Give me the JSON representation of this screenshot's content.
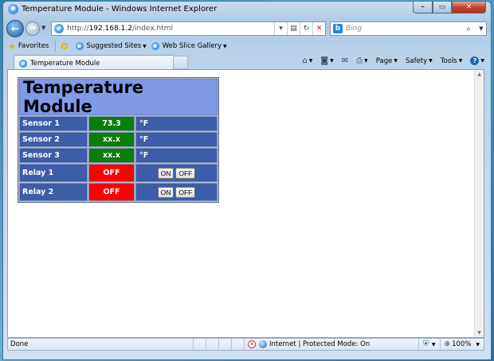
{
  "window": {
    "title": "Temperature Module - Windows Internet Explorer",
    "controls": {
      "minimize": "–",
      "maximize": "▭",
      "close": "✕"
    }
  },
  "address_bar": {
    "url_prefix": "http://",
    "url_host": "192.168.1.2",
    "url_path": "/index.html",
    "search_placeholder": "Bing",
    "bing_glyph": "b"
  },
  "favorites_bar": {
    "favorites_label": "Favorites",
    "suggested_sites": "Suggested Sites",
    "web_slice_gallery": "Web Slice Gallery"
  },
  "tabs": [
    {
      "label": "Temperature Module"
    }
  ],
  "command_bar": {
    "page": "Page",
    "safety": "Safety",
    "tools": "Tools"
  },
  "page": {
    "title": "Temperature Module",
    "sensors": [
      {
        "label": "Sensor 1",
        "value": "73.3",
        "unit": "°F"
      },
      {
        "label": "Sensor 2",
        "value": "xx.x",
        "unit": "°F"
      },
      {
        "label": "Sensor 3",
        "value": "xx.x",
        "unit": "°F"
      }
    ],
    "relays": [
      {
        "label": "Relay 1",
        "state": "OFF",
        "on_label": "ON",
        "off_label": "OFF"
      },
      {
        "label": "Relay 2",
        "state": "OFF",
        "on_label": "ON",
        "off_label": "OFF"
      }
    ]
  },
  "status_bar": {
    "status": "Done",
    "zone": "Internet | Protected Mode: On",
    "zoom": "100%"
  },
  "colors": {
    "title_bg": "#7f9ae6",
    "cell_blue": "#3c5da8",
    "value_green": "#0a7d0a",
    "value_red": "#ff0000"
  }
}
